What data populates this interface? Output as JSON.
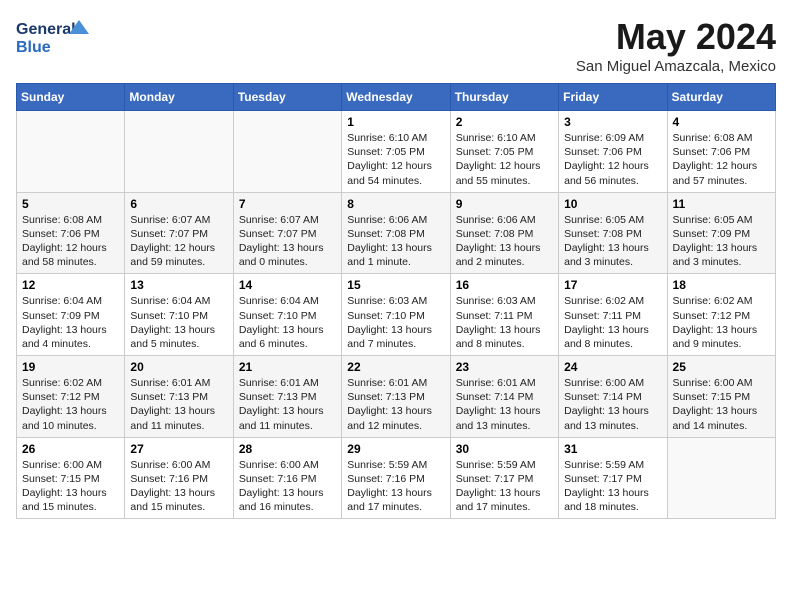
{
  "header": {
    "logo_line1": "General",
    "logo_line2": "Blue",
    "month_title": "May 2024",
    "location": "San Miguel Amazcala, Mexico"
  },
  "days_of_week": [
    "Sunday",
    "Monday",
    "Tuesday",
    "Wednesday",
    "Thursday",
    "Friday",
    "Saturday"
  ],
  "weeks": [
    [
      {
        "day": "",
        "info": ""
      },
      {
        "day": "",
        "info": ""
      },
      {
        "day": "",
        "info": ""
      },
      {
        "day": "1",
        "info": "Sunrise: 6:10 AM\nSunset: 7:05 PM\nDaylight: 12 hours\nand 54 minutes."
      },
      {
        "day": "2",
        "info": "Sunrise: 6:10 AM\nSunset: 7:05 PM\nDaylight: 12 hours\nand 55 minutes."
      },
      {
        "day": "3",
        "info": "Sunrise: 6:09 AM\nSunset: 7:06 PM\nDaylight: 12 hours\nand 56 minutes."
      },
      {
        "day": "4",
        "info": "Sunrise: 6:08 AM\nSunset: 7:06 PM\nDaylight: 12 hours\nand 57 minutes."
      }
    ],
    [
      {
        "day": "5",
        "info": "Sunrise: 6:08 AM\nSunset: 7:06 PM\nDaylight: 12 hours\nand 58 minutes."
      },
      {
        "day": "6",
        "info": "Sunrise: 6:07 AM\nSunset: 7:07 PM\nDaylight: 12 hours\nand 59 minutes."
      },
      {
        "day": "7",
        "info": "Sunrise: 6:07 AM\nSunset: 7:07 PM\nDaylight: 13 hours\nand 0 minutes."
      },
      {
        "day": "8",
        "info": "Sunrise: 6:06 AM\nSunset: 7:08 PM\nDaylight: 13 hours\nand 1 minute."
      },
      {
        "day": "9",
        "info": "Sunrise: 6:06 AM\nSunset: 7:08 PM\nDaylight: 13 hours\nand 2 minutes."
      },
      {
        "day": "10",
        "info": "Sunrise: 6:05 AM\nSunset: 7:08 PM\nDaylight: 13 hours\nand 3 minutes."
      },
      {
        "day": "11",
        "info": "Sunrise: 6:05 AM\nSunset: 7:09 PM\nDaylight: 13 hours\nand 3 minutes."
      }
    ],
    [
      {
        "day": "12",
        "info": "Sunrise: 6:04 AM\nSunset: 7:09 PM\nDaylight: 13 hours\nand 4 minutes."
      },
      {
        "day": "13",
        "info": "Sunrise: 6:04 AM\nSunset: 7:10 PM\nDaylight: 13 hours\nand 5 minutes."
      },
      {
        "day": "14",
        "info": "Sunrise: 6:04 AM\nSunset: 7:10 PM\nDaylight: 13 hours\nand 6 minutes."
      },
      {
        "day": "15",
        "info": "Sunrise: 6:03 AM\nSunset: 7:10 PM\nDaylight: 13 hours\nand 7 minutes."
      },
      {
        "day": "16",
        "info": "Sunrise: 6:03 AM\nSunset: 7:11 PM\nDaylight: 13 hours\nand 8 minutes."
      },
      {
        "day": "17",
        "info": "Sunrise: 6:02 AM\nSunset: 7:11 PM\nDaylight: 13 hours\nand 8 minutes."
      },
      {
        "day": "18",
        "info": "Sunrise: 6:02 AM\nSunset: 7:12 PM\nDaylight: 13 hours\nand 9 minutes."
      }
    ],
    [
      {
        "day": "19",
        "info": "Sunrise: 6:02 AM\nSunset: 7:12 PM\nDaylight: 13 hours\nand 10 minutes."
      },
      {
        "day": "20",
        "info": "Sunrise: 6:01 AM\nSunset: 7:13 PM\nDaylight: 13 hours\nand 11 minutes."
      },
      {
        "day": "21",
        "info": "Sunrise: 6:01 AM\nSunset: 7:13 PM\nDaylight: 13 hours\nand 11 minutes."
      },
      {
        "day": "22",
        "info": "Sunrise: 6:01 AM\nSunset: 7:13 PM\nDaylight: 13 hours\nand 12 minutes."
      },
      {
        "day": "23",
        "info": "Sunrise: 6:01 AM\nSunset: 7:14 PM\nDaylight: 13 hours\nand 13 minutes."
      },
      {
        "day": "24",
        "info": "Sunrise: 6:00 AM\nSunset: 7:14 PM\nDaylight: 13 hours\nand 13 minutes."
      },
      {
        "day": "25",
        "info": "Sunrise: 6:00 AM\nSunset: 7:15 PM\nDaylight: 13 hours\nand 14 minutes."
      }
    ],
    [
      {
        "day": "26",
        "info": "Sunrise: 6:00 AM\nSunset: 7:15 PM\nDaylight: 13 hours\nand 15 minutes."
      },
      {
        "day": "27",
        "info": "Sunrise: 6:00 AM\nSunset: 7:16 PM\nDaylight: 13 hours\nand 15 minutes."
      },
      {
        "day": "28",
        "info": "Sunrise: 6:00 AM\nSunset: 7:16 PM\nDaylight: 13 hours\nand 16 minutes."
      },
      {
        "day": "29",
        "info": "Sunrise: 5:59 AM\nSunset: 7:16 PM\nDaylight: 13 hours\nand 17 minutes."
      },
      {
        "day": "30",
        "info": "Sunrise: 5:59 AM\nSunset: 7:17 PM\nDaylight: 13 hours\nand 17 minutes."
      },
      {
        "day": "31",
        "info": "Sunrise: 5:59 AM\nSunset: 7:17 PM\nDaylight: 13 hours\nand 18 minutes."
      },
      {
        "day": "",
        "info": ""
      }
    ]
  ]
}
